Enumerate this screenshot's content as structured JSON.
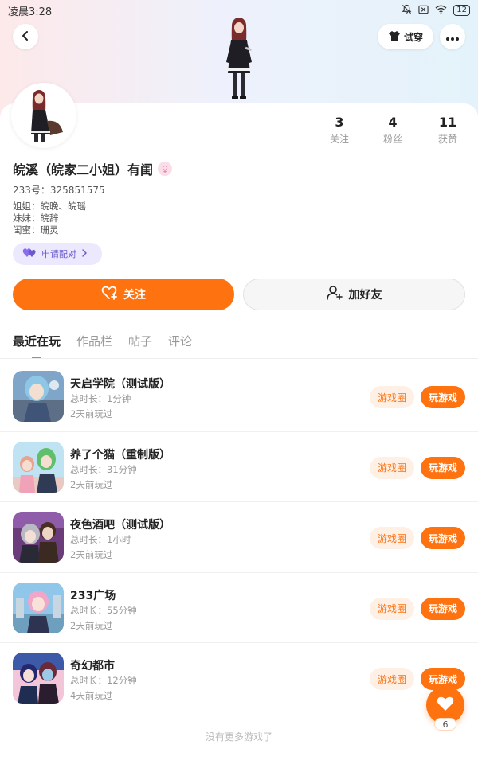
{
  "status_bar": {
    "time": "凌晨3:28",
    "battery": "12"
  },
  "header": {
    "try_on_label": "试穿"
  },
  "profile": {
    "name": "皖溪（皖家二小姐）有闺",
    "gender_symbol": "♀",
    "uid": "233号：325851575",
    "bio_lines": [
      "姐姐：皖晚、皖瑶",
      "妹妹：皖辞",
      "闺蜜：珊灵"
    ],
    "pair_label": "申请配对"
  },
  "stats": [
    {
      "value": "3",
      "label": "关注"
    },
    {
      "value": "4",
      "label": "粉丝"
    },
    {
      "value": "11",
      "label": "获赞"
    }
  ],
  "actions": {
    "follow_label": "关注",
    "add_friend_label": "加好友"
  },
  "tabs": [
    {
      "label": "最近在玩",
      "active": true
    },
    {
      "label": "作品栏",
      "active": false
    },
    {
      "label": "帖子",
      "active": false
    },
    {
      "label": "评论",
      "active": false
    }
  ],
  "games": [
    {
      "name": "天启学院（测试版）",
      "duration": "总时长：1分钟",
      "last_played": "2天前玩过",
      "circle_label": "游戏圈",
      "play_label": "玩游戏"
    },
    {
      "name": "养了个猫（重制版）",
      "duration": "总时长：31分钟",
      "last_played": "2天前玩过",
      "circle_label": "游戏圈",
      "play_label": "玩游戏"
    },
    {
      "name": "夜色酒吧（测试版）",
      "duration": "总时长：1小时",
      "last_played": "2天前玩过",
      "circle_label": "游戏圈",
      "play_label": "玩游戏"
    },
    {
      "name": "233广场",
      "duration": "总时长：55分钟",
      "last_played": "2天前玩过",
      "circle_label": "游戏圈",
      "play_label": "玩游戏"
    },
    {
      "name": "奇幻都市",
      "duration": "总时长：12分钟",
      "last_played": "4天前玩过",
      "circle_label": "游戏圈",
      "play_label": "玩游戏"
    }
  ],
  "footer": {
    "no_more_text": "没有更多游戏了"
  },
  "like_fab": {
    "count": "6"
  },
  "colors": {
    "accent": "#ff7210",
    "accent_light": "#fff0e6",
    "pair_bg": "#ece9ff",
    "pair_fg": "#6a5acd"
  }
}
